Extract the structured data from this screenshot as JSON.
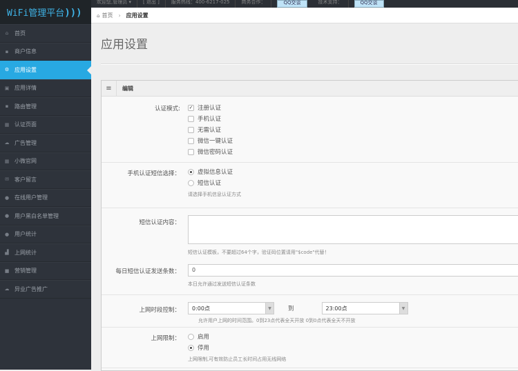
{
  "logo": {
    "text": "WiFi管理平台"
  },
  "topbar": {
    "items": [
      "欢迎您,管理员 ▾",
      "[ 退出 ]",
      "服务热线：400-6217-025",
      "商务合作：",
      "QQ交谈",
      "技术支持：",
      "QQ交谈"
    ]
  },
  "sidebar": {
    "items": [
      {
        "label": "首页",
        "icon": "home-icon"
      },
      {
        "label": "商户信息",
        "icon": "users-icon"
      },
      {
        "label": "应用设置",
        "icon": "cogs-icon",
        "active": true
      },
      {
        "label": "应用详情",
        "icon": "checkbox-icon"
      },
      {
        "label": "路由管理",
        "icon": "router-icon"
      },
      {
        "label": "认证页面",
        "icon": "grid-icon"
      },
      {
        "label": "广告管理",
        "icon": "cloud-icon"
      },
      {
        "label": "小微官网",
        "icon": "tiles-icon"
      },
      {
        "label": "客户留言",
        "icon": "envelope-icon"
      },
      {
        "label": "在线用户管理",
        "icon": "user-icon"
      },
      {
        "label": "用户黑白名单管理",
        "icon": "user-icon"
      },
      {
        "label": "用户统计",
        "icon": "user-icon"
      },
      {
        "label": "上网统计",
        "icon": "signal-icon"
      },
      {
        "label": "营销管理",
        "icon": "briefcase-icon"
      },
      {
        "label": "异业广告推广",
        "icon": "cloud-icon"
      }
    ]
  },
  "breadcrumb": {
    "home": "首页",
    "current": "应用设置"
  },
  "page": {
    "title": "应用设置"
  },
  "panel": {
    "title": "编辑"
  },
  "form": {
    "auth_mode": {
      "label": "认证模式:",
      "options": [
        {
          "label": "注册认证",
          "checked": true
        },
        {
          "label": "手机认证",
          "checked": false
        },
        {
          "label": "无需认证",
          "checked": false
        },
        {
          "label": "微信一键认证",
          "checked": false
        },
        {
          "label": "微信密码认证",
          "checked": false
        }
      ]
    },
    "sms_choice": {
      "label": "手机认证短信选择：",
      "options": [
        {
          "label": "虚拟信息认证",
          "selected": true
        },
        {
          "label": "短信认证",
          "selected": false
        }
      ],
      "help": "请选择手机信息认证方式"
    },
    "sms_content": {
      "label": "短信认证内容：",
      "value": "",
      "help": "短信认证模板，不要超过64个字，验证码位置请用\"$code\"代替！"
    },
    "sms_daily": {
      "label": "每日短信认证发送条数：",
      "value": "0",
      "help": "本日允许通过发送短信认证条数"
    },
    "time_ctrl": {
      "label": "上网时段控制：",
      "from": "0:00点",
      "to_label": "到",
      "to": "23:00点",
      "help": "允许用户上网的时间范围。0到23点代表全天开放 0到0点代表全天不开放"
    },
    "net_limit": {
      "label": "上网限制：",
      "options": [
        {
          "label": "启用",
          "selected": false
        },
        {
          "label": "停用",
          "selected": true
        }
      ],
      "help": "上网限制,可有效防止员工长时间占用无线网络"
    }
  }
}
